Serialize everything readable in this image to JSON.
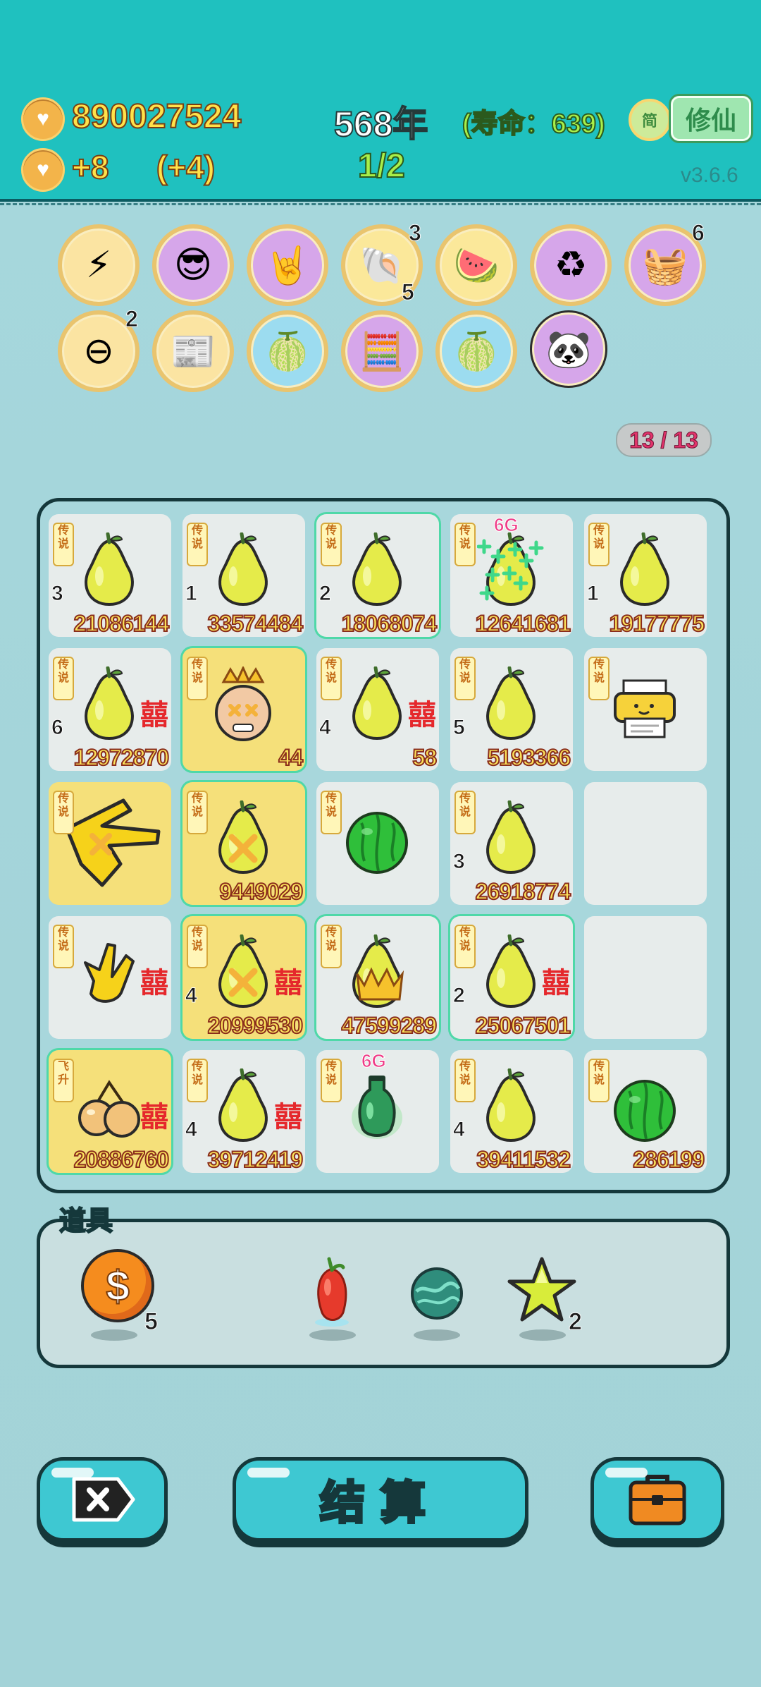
{
  "header": {
    "coins": "890027524",
    "year": "568年",
    "lifespan": "(寿命：639)",
    "income": "+8",
    "income_bonus": "(+4)",
    "progress": "1/2",
    "jian_label": "简",
    "xiu_button": "修仙",
    "version": "v3.6.6"
  },
  "relics": {
    "row1": [
      {
        "icon": "lightning-icon",
        "glyph": "⚡"
      },
      {
        "icon": "cool-peach-icon",
        "glyph": "😎"
      },
      {
        "icon": "rock-hand-icon",
        "glyph": "🤘"
      },
      {
        "icon": "seashell-icon",
        "glyph": "🐚",
        "count_top": "3",
        "count_bottom": "5"
      },
      {
        "icon": "fruit-platter-icon",
        "glyph": "🍉"
      },
      {
        "icon": "recycle-icon",
        "glyph": "♻"
      },
      {
        "icon": "fruit-basket-icon",
        "glyph": "🧺",
        "count_top": "6"
      }
    ],
    "row2": [
      {
        "icon": "minus-icon",
        "glyph": "⊖",
        "count_top": "2"
      },
      {
        "icon": "time-magazine-icon",
        "glyph": "📰"
      },
      {
        "icon": "grapefruit-icon",
        "glyph": "🍈"
      },
      {
        "icon": "math-kid-icon",
        "glyph": "🧮"
      },
      {
        "icon": "grapefruit-blue-icon",
        "glyph": "🍈"
      },
      {
        "icon": "panda-icon",
        "glyph": "🐼"
      }
    ]
  },
  "counter": "13 / 13",
  "board": {
    "tag": "传说",
    "tag_fly": "飞升",
    "xi": "囍",
    "sixg": "6G",
    "cells": [
      {
        "kind": "pomelo",
        "lvl": "3",
        "num": "21086144"
      },
      {
        "kind": "pomelo",
        "lvl": "1",
        "num": "33574484"
      },
      {
        "kind": "pomelo",
        "lvl": "2",
        "num": "18068074",
        "glow": true
      },
      {
        "kind": "pomelo-plus",
        "num": "12641681",
        "sixg": true
      },
      {
        "kind": "pomelo",
        "lvl": "1",
        "num": "19177775"
      },
      {
        "kind": "pomelo",
        "lvl": "6",
        "num": "12972870",
        "xi": true
      },
      {
        "kind": "king-face",
        "num": "44",
        "gold": true,
        "glow": true
      },
      {
        "kind": "pomelo",
        "lvl": "4",
        "num": "58",
        "xi": true
      },
      {
        "kind": "pomelo",
        "lvl": "5",
        "num": "5193366"
      },
      {
        "kind": "printer"
      },
      {
        "kind": "hand-point",
        "gold": true
      },
      {
        "kind": "pomelo-x",
        "num": "9449029",
        "gold": true,
        "glow": true
      },
      {
        "kind": "watermelon"
      },
      {
        "kind": "pomelo",
        "lvl": "3",
        "num": "26918774"
      },
      {
        "kind": "empty"
      },
      {
        "kind": "rock-hand",
        "xi": true
      },
      {
        "kind": "pomelo-x",
        "lvl": "4",
        "num": "20999530",
        "gold": true,
        "glow": true,
        "xi": true
      },
      {
        "kind": "pomelo-crown",
        "num": "47599289",
        "glow": true
      },
      {
        "kind": "pomelo",
        "lvl": "2",
        "num": "25067501",
        "glow": true,
        "xi": true
      },
      {
        "kind": "empty"
      },
      {
        "kind": "peaches",
        "num": "20886760",
        "gold": true,
        "glow": true,
        "xi": true,
        "fly": true
      },
      {
        "kind": "pomelo",
        "lvl": "4",
        "num": "39712419",
        "xi": true
      },
      {
        "kind": "vase",
        "sixg": true
      },
      {
        "kind": "pomelo",
        "lvl": "4",
        "num": "39411532"
      },
      {
        "kind": "watermelon",
        "num": "286199"
      }
    ]
  },
  "items": {
    "title": "道具",
    "list": [
      {
        "name": "coin-item",
        "count": "5"
      },
      {
        "name": "chili-item",
        "count": ""
      },
      {
        "name": "orb-item",
        "count": ""
      },
      {
        "name": "star-item",
        "count": "2"
      }
    ]
  },
  "buttons": {
    "settle": "结算"
  },
  "colors": {
    "header_bg": "#1fc1bf",
    "body_bg": "#a6d8dd",
    "button_bg": "#3ec8d2",
    "number_gold": "#fbe35a"
  }
}
